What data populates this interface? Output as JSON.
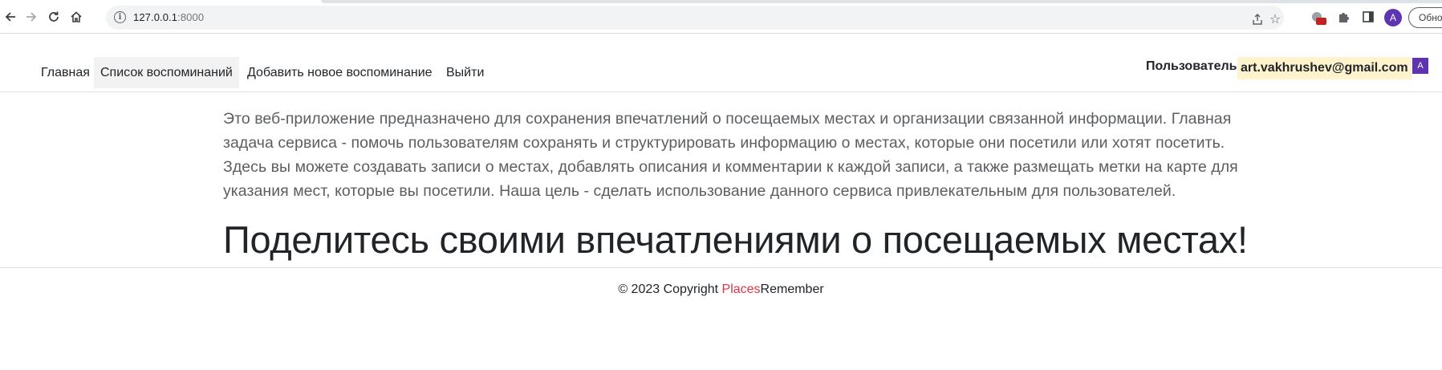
{
  "browser": {
    "url_host": "127.0.0.1",
    "url_port": ":8000",
    "profile_initial": "A",
    "update_label": "Обно",
    "icons": {
      "back": "back-arrow-icon",
      "forward": "forward-arrow-icon",
      "reload": "reload-icon",
      "home": "home-icon",
      "info": "info-icon",
      "share": "share-icon",
      "bookmark": "star-icon",
      "extension": "extension-icon",
      "puzzle": "puzzle-icon",
      "sidepanel": "side-panel-icon"
    }
  },
  "navbar": {
    "items": [
      {
        "label": "Главная",
        "active": false
      },
      {
        "label": "Список воспоминаний",
        "active": true
      },
      {
        "label": "Добавить новое воспоминание",
        "active": false
      },
      {
        "label": "Выйти",
        "active": false
      }
    ],
    "user_label": "Пользователь:",
    "user_email": "art.vakhrushev@gmail.com",
    "user_avatar_initial": "A"
  },
  "main": {
    "lead": "Это веб-приложение предназначено для сохранения впечатлений о посещаемых местах и организации связанной информации. Главная задача сервиса - помочь пользователям сохранять и структурировать информацию о местах, которые они посетили или хотят посетить. Здесь вы можете создавать записи о местах, добавлять описания и комментарии к каждой записи, а также размещать метки на карте для указания мест, которые вы посетили. Наша цель - сделать использование данного сервиса привлекательным для пользователей.",
    "headline": "Поделитесь своими впечатлениями о посещаемых местах!"
  },
  "footer": {
    "copyright": "© 2023 Copyright ",
    "brand_part1": "Places",
    "brand_part2": "Remember"
  },
  "colors": {
    "brand_accent": "#dc3545",
    "email_highlight": "#fff3cd",
    "avatar": "#5e35b1"
  }
}
